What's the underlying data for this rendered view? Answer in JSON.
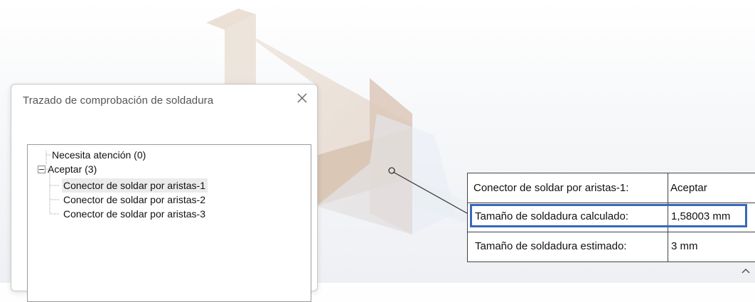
{
  "dialog": {
    "title": "Trazado de comprobación de soldadura",
    "close_icon": "close-icon",
    "tree": {
      "items": [
        {
          "label": "Necesita atención (0)"
        },
        {
          "label": "Aceptar (3)",
          "expanded": true
        },
        {
          "label": "Conector de soldar por aristas-1",
          "selected": true
        },
        {
          "label": "Conector de soldar por aristas-2"
        },
        {
          "label": "Conector de soldar por aristas-3"
        }
      ]
    }
  },
  "callout": {
    "rows": [
      {
        "label": "Conector de soldar por aristas-1:",
        "value": "Aceptar"
      },
      {
        "label": "Tamaño de soldadura calculado:",
        "value": "1,58003 mm",
        "highlighted": true
      },
      {
        "label": "Tamaño de soldadura estimado:",
        "value": "3 mm"
      }
    ]
  },
  "colors": {
    "highlight": "#3a68b8",
    "part_face": "#e8dcd2",
    "part_shade": "#d8c3b2"
  },
  "icons": {
    "expander": "minus-box-icon",
    "scroll": "chevron-up-icon"
  }
}
